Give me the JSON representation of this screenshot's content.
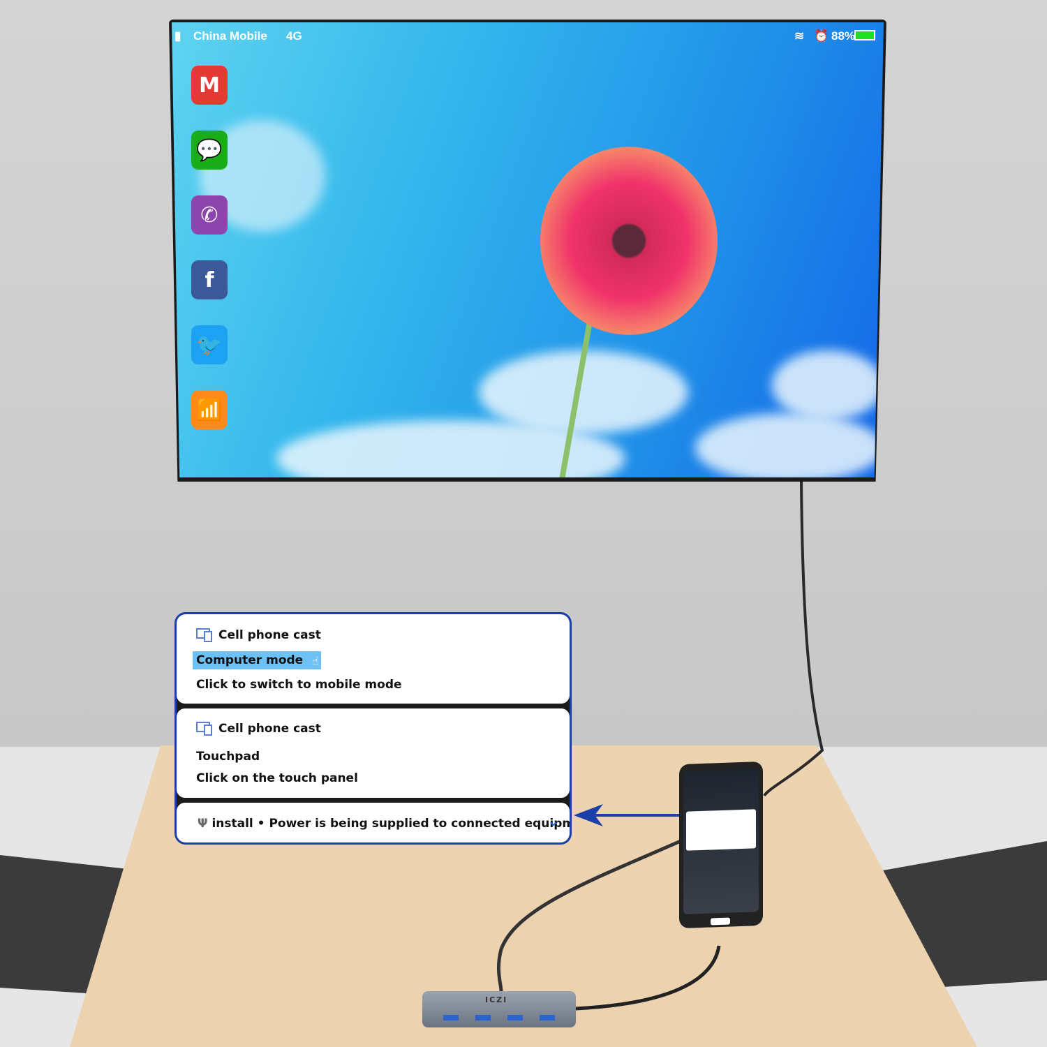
{
  "tv": {
    "status_bar": {
      "carrier": "China Mobile",
      "network": "4G",
      "battery": "88%",
      "icons": [
        "signal-icon",
        "wifi-icon",
        "alarm-icon",
        "battery-icon"
      ]
    },
    "apps": [
      {
        "name": "gmail",
        "label": "M",
        "color": "#e53935"
      },
      {
        "name": "wechat",
        "label": "💬",
        "color": "#1aad19"
      },
      {
        "name": "viber",
        "label": "✆",
        "color": "#8e44ad"
      },
      {
        "name": "facebook",
        "label": "f",
        "color": "#3b5998"
      },
      {
        "name": "twitter",
        "label": "🐦",
        "color": "#1da1f2"
      },
      {
        "name": "wifi",
        "label": "📶",
        "color": "#ff8a1c"
      }
    ]
  },
  "callout": {
    "card1": {
      "title": "Cell phone cast",
      "highlight": "Computer mode",
      "subtitle": "Click to switch to mobile mode"
    },
    "card2": {
      "title": "Cell phone cast",
      "line1": "Touchpad",
      "line2": "Click on the touch panel"
    },
    "card3": {
      "text": "install • Power is being supplied to connected equipment"
    },
    "accent": "#1a3fa8",
    "highlight_color": "#6ec1f5"
  },
  "hub": {
    "brand": "ICZI"
  }
}
